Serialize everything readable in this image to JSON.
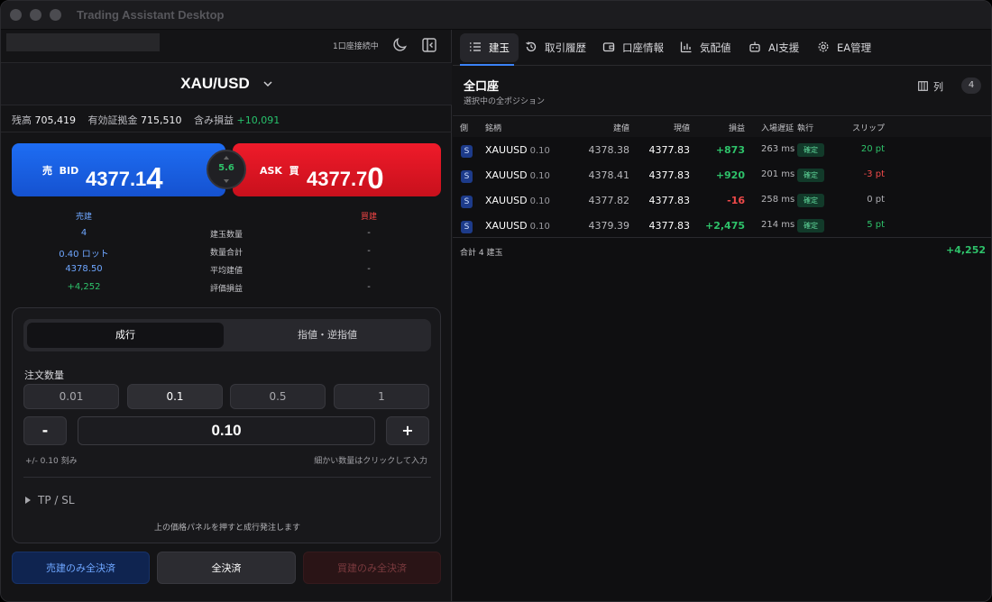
{
  "window": {
    "title": "Trading Assistant Desktop"
  },
  "left": {
    "connection_status": "1口座接続中",
    "symbol": "XAU/USD",
    "account": {
      "balance_label": "残高",
      "balance": "705,419",
      "margin_label": "有効証拠金",
      "margin": "715,510",
      "unrealized_label": "含み損益",
      "unrealized": "+10,091"
    },
    "bid": {
      "side": "売",
      "label": "BID",
      "price_head": "4377.1",
      "price_tail": "4"
    },
    "ask": {
      "label": "ASK",
      "side": "買",
      "price_head": "4377.7",
      "price_tail": "0"
    },
    "spread": "5.6",
    "positions": {
      "sell_header": "売建",
      "buy_header": "買建",
      "rows": [
        {
          "label": "建玉数量",
          "sell": "4",
          "buy": "-"
        },
        {
          "label": "数量合計",
          "sell": "0.40 ロット",
          "buy": "-"
        },
        {
          "label": "平均建値",
          "sell": "4378.50",
          "buy": "-"
        },
        {
          "label": "評価損益",
          "sell": "+4,252",
          "buy": "-"
        }
      ]
    },
    "order": {
      "tab_market": "成行",
      "tab_limit": "指値・逆指値",
      "qty_label": "注文数量",
      "presets": [
        "0.01",
        "0.1",
        "0.5",
        "1"
      ],
      "selected_preset": "0.1",
      "minus": "-",
      "plus": "+",
      "qty_value": "0.10",
      "step_hint": "+/- 0.10 刻み",
      "fine_hint": "細かい数量はクリックして入力",
      "tpsl": "TP / SL",
      "note": "上の価格パネルを押すと成行発注します"
    },
    "close_buttons": {
      "sell_only": "売建のみ全決済",
      "all": "全決済",
      "buy_only": "買建のみ全決済"
    }
  },
  "right": {
    "tabs": [
      "建玉",
      "取引履歴",
      "口座情報",
      "気配値",
      "AI支援",
      "EA管理"
    ],
    "active_tab": "建玉",
    "account_title": "全口座",
    "account_subtitle": "選択中の全ポジション",
    "columns_button": "列",
    "count": "4",
    "headers": {
      "side": "側",
      "symbol": "銘柄",
      "open": "建値",
      "current": "現値",
      "pnl": "損益",
      "latency": "入場遅延",
      "exec": "執行",
      "slip": "スリップ"
    },
    "rows": [
      {
        "side": "S",
        "symbol": "XAUUSD",
        "lot": "0.10",
        "open": "4378.38",
        "current": "4377.83",
        "pnl": "+873",
        "latency": "263 ms",
        "exec": "確定",
        "slip": "20 pt",
        "pnl_sign": "pos",
        "slip_sign": "pos"
      },
      {
        "side": "S",
        "symbol": "XAUUSD",
        "lot": "0.10",
        "open": "4378.41",
        "current": "4377.83",
        "pnl": "+920",
        "latency": "201 ms",
        "exec": "確定",
        "slip": "-3 pt",
        "pnl_sign": "pos",
        "slip_sign": "neg"
      },
      {
        "side": "S",
        "symbol": "XAUUSD",
        "lot": "0.10",
        "open": "4377.82",
        "current": "4377.83",
        "pnl": "-16",
        "latency": "258 ms",
        "exec": "確定",
        "slip": "0 pt",
        "pnl_sign": "neg",
        "slip_sign": "zero"
      },
      {
        "side": "S",
        "symbol": "XAUUSD",
        "lot": "0.10",
        "open": "4379.39",
        "current": "4377.83",
        "pnl": "+2,475",
        "latency": "214 ms",
        "exec": "確定",
        "slip": "5 pt",
        "pnl_sign": "pos",
        "slip_sign": "pos"
      }
    ],
    "footer_label": "合計 4 建玉",
    "footer_total": "+4,252"
  },
  "colors": {
    "bid": "#1e6df3",
    "ask": "#ef1b2a",
    "positive": "#2ec26a",
    "negative": "#f04a4a",
    "accent": "#3b82f6"
  }
}
